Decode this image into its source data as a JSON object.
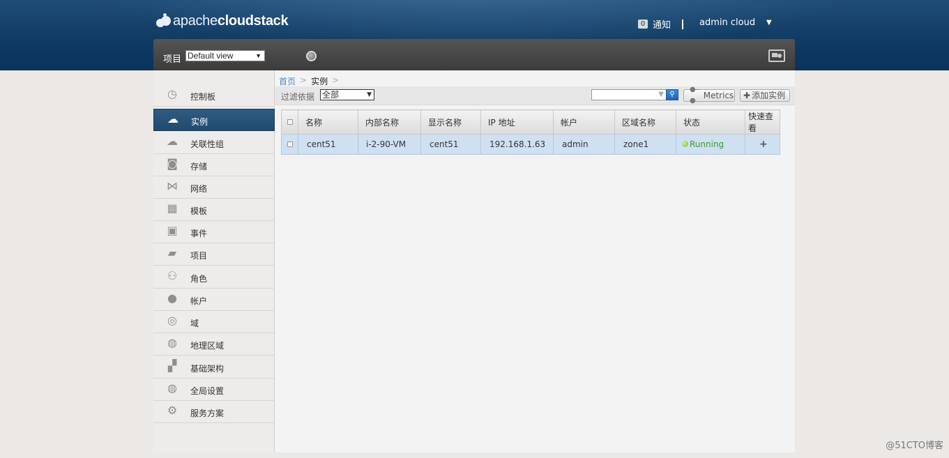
{
  "header": {
    "logo_prefix": "apache",
    "logo_bold": "cloudstack",
    "notification_count": "0",
    "notification_label": "通知",
    "user_name": "admin cloud",
    "user_caret": "▼"
  },
  "project_bar": {
    "label": "项目",
    "selected_view": "Default view",
    "icons": [
      "globe-icon",
      "card-icon"
    ]
  },
  "sidebar": {
    "items": [
      {
        "label": "控制板",
        "icon": "dashboard-icon",
        "active": false
      },
      {
        "label": "实例",
        "icon": "cloud-icon",
        "active": true
      },
      {
        "label": "关联性组",
        "icon": "affinity-icon",
        "active": false
      },
      {
        "label": "存储",
        "icon": "storage-icon",
        "active": false
      },
      {
        "label": "网络",
        "icon": "network-icon",
        "active": false
      },
      {
        "label": "模板",
        "icon": "template-icon",
        "active": false
      },
      {
        "label": "事件",
        "icon": "calendar-icon",
        "active": false
      },
      {
        "label": "项目",
        "icon": "folder-icon",
        "active": false
      },
      {
        "label": "角色",
        "icon": "roles-icon",
        "active": false
      },
      {
        "label": "帐户",
        "icon": "user-icon",
        "active": false
      },
      {
        "label": "域",
        "icon": "domain-icon",
        "active": false
      },
      {
        "label": "地理区域",
        "icon": "globe-icon",
        "active": false
      },
      {
        "label": "基础架构",
        "icon": "infrastructure-icon",
        "active": false
      },
      {
        "label": "全局设置",
        "icon": "global-settings-icon",
        "active": false
      },
      {
        "label": "服务方案",
        "icon": "gear-icon",
        "active": false
      }
    ]
  },
  "breadcrumb": {
    "home": "首页",
    "separator": ">",
    "current": "实例",
    "trailing_separator": ">"
  },
  "toolbar": {
    "filter_label": "过滤依据",
    "filter_value": "全部",
    "search_placeholder": "",
    "metrics_label": "Metrics",
    "add_label": "添加实例"
  },
  "table": {
    "columns": [
      "名称",
      "内部名称",
      "显示名称",
      "IP 地址",
      "帐户",
      "区域名称",
      "状态",
      "快速查看"
    ],
    "rows": [
      {
        "name": "cent51",
        "internal_name": "i-2-90-VM",
        "display_name": "cent51",
        "ip": "192.168.1.63",
        "account": "admin",
        "zone": "zone1",
        "state": "Running",
        "quickview": "+"
      }
    ]
  },
  "watermark": "@51CTO博客",
  "colors": {
    "header_bg": "#0f3a62",
    "active_nav": "#2a577d",
    "row_selected": "#cfe0f3",
    "running": "#3a9a2e",
    "link": "#4c8bc6"
  }
}
